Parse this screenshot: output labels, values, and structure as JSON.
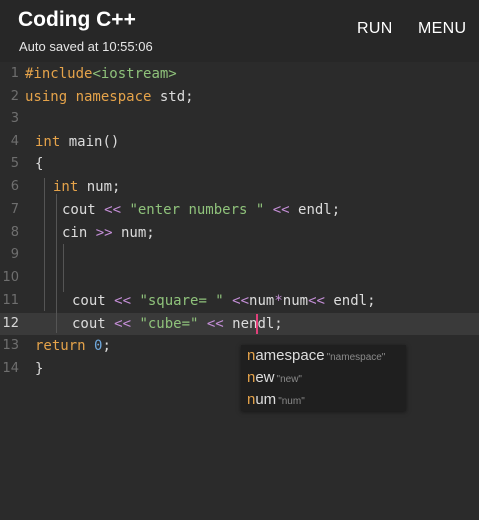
{
  "appbar": {
    "title": "Coding C++",
    "subtitle": "Auto saved at 10:55:06",
    "run_label": "RUN",
    "menu_label": "MENU"
  },
  "editor": {
    "line_numbers": [
      "1",
      "2",
      "3",
      "4",
      "5",
      "6",
      "7",
      "8",
      "9",
      "10",
      "11",
      "12",
      "13",
      "14"
    ],
    "active_line": "12",
    "lines": {
      "l1": {
        "directive": "#include",
        "header": "<iostream>"
      },
      "l2": {
        "kw": "using namespace",
        "rest": " std;"
      },
      "l4": {
        "kw": "int",
        "rest": " main()"
      },
      "l5": {
        "text": "{"
      },
      "l6": {
        "kw": "int",
        "rest": " num;"
      },
      "l7": {
        "a": "cout ",
        "op1": "<<",
        "str": " \"enter numbers \" ",
        "op2": "<<",
        "b": " endl;"
      },
      "l8": {
        "a": "cin ",
        "op1": ">>",
        "b": " num;"
      },
      "l11": {
        "a": "cout ",
        "op1": "<<",
        "str": " \"square= \" ",
        "op2": "<<",
        "b": "num",
        "op3": "*",
        "c": "num",
        "op4": "<<",
        "d": " endl;"
      },
      "l12": {
        "a": "cout ",
        "op1": "<<",
        "str": " \"cube=\" ",
        "op2": "<<",
        "b": " nendl;"
      },
      "l13": {
        "kw": "return",
        "space": " ",
        "num": "0",
        "rest": ";"
      },
      "l14": {
        "text": "}"
      }
    }
  },
  "autocomplete": {
    "items": [
      {
        "match": "n",
        "rest": "amespace",
        "hint": "\"namespace\""
      },
      {
        "match": "n",
        "rest": "ew",
        "hint": "\"new\""
      },
      {
        "match": "n",
        "rest": "um",
        "hint": "\"num\""
      }
    ]
  },
  "colors": {
    "keyword": "#e5a34a",
    "string": "#8fc27b",
    "operator": "#c58fd8",
    "number": "#6fa8dc",
    "cursor": "#e0407a",
    "background": "#2b2b2b"
  }
}
